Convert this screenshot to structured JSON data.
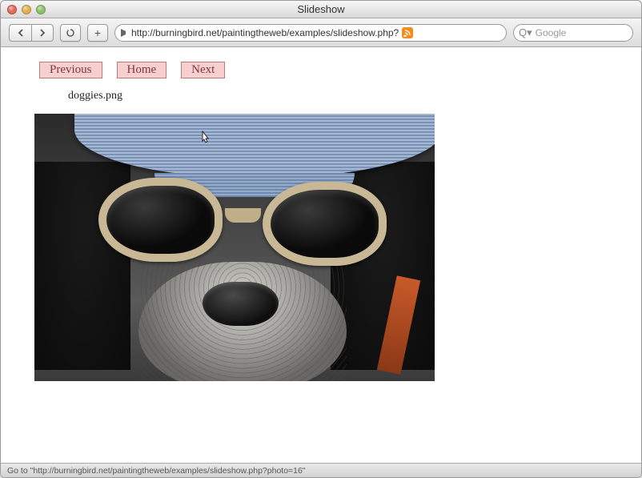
{
  "window": {
    "title": "Slideshow"
  },
  "toolbar": {
    "url": "http://burningbird.net/paintingtheweb/examples/slideshow.php?",
    "search_placeholder": "Google"
  },
  "nav": {
    "previous": "Previous",
    "home": "Home",
    "next": "Next"
  },
  "image": {
    "caption": "doggies.png"
  },
  "status": {
    "text": "Go to \"http://burningbird.net/paintingtheweb/examples/slideshow.php?photo=16\""
  }
}
